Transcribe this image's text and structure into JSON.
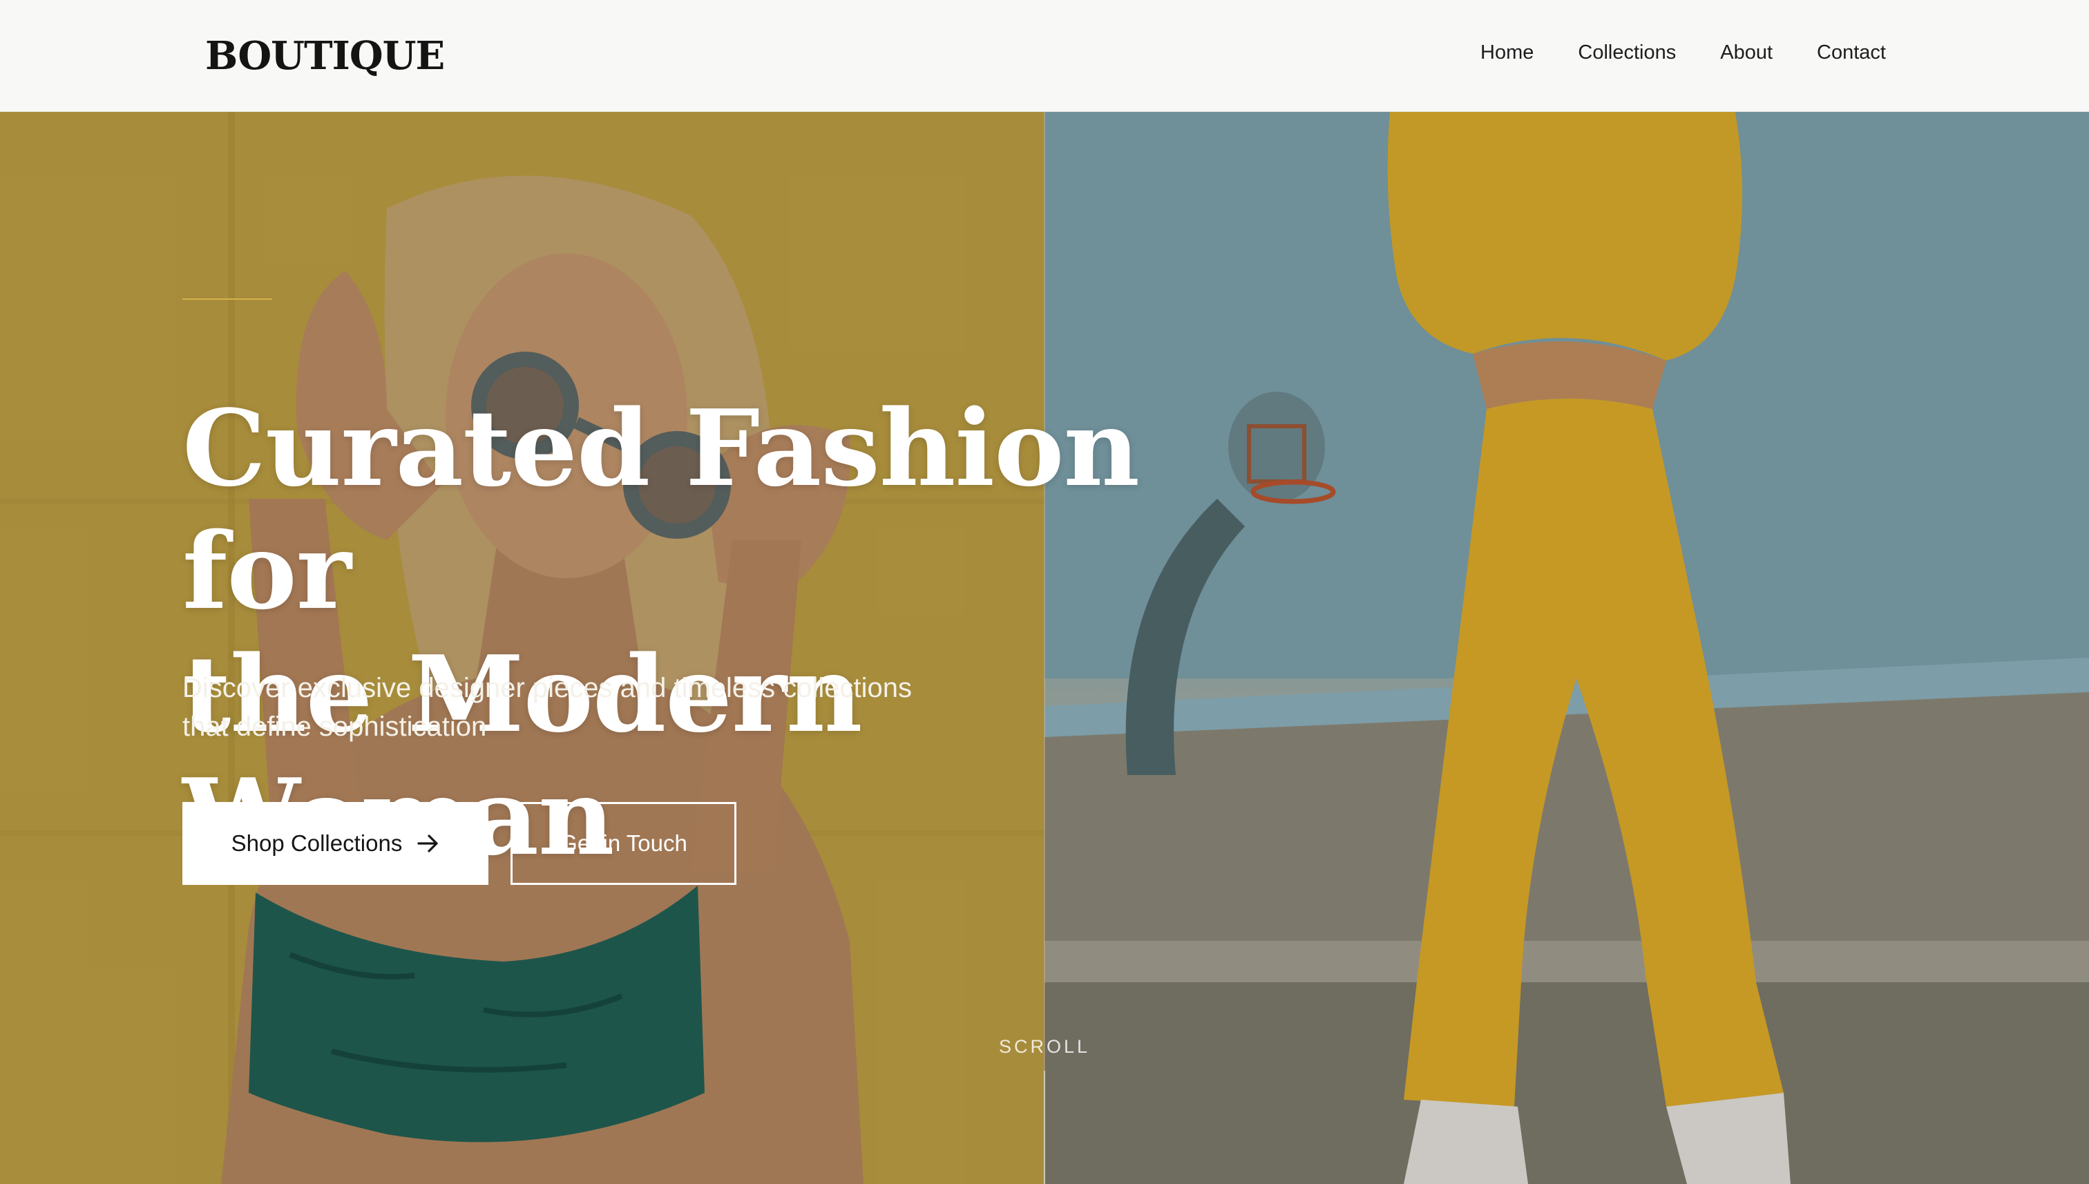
{
  "brand": {
    "logo": "BOUTIQUE"
  },
  "nav": {
    "items": [
      {
        "label": "Home"
      },
      {
        "label": "Collections"
      },
      {
        "label": "About"
      },
      {
        "label": "Contact"
      }
    ]
  },
  "hero": {
    "title_line1": "Curated Fashion for",
    "title_line2": "the Modern Woman",
    "subtitle_line1": "Discover exclusive designer pieces and timeless collections",
    "subtitle_line2": "that define sophistication",
    "primary_button": "Shop Collections",
    "secondary_button": "Get in Touch",
    "scroll_label": "SCROLL"
  },
  "colors": {
    "header_bg": "#f8f8f6",
    "accent": "#d4b24a",
    "left_photo_tone": "#c6a84a",
    "right_photo_tone": "#8fb3bf",
    "outfit_yellow": "#e8b62a"
  },
  "icons": {
    "primary_button_icon": "arrow-right-icon"
  }
}
